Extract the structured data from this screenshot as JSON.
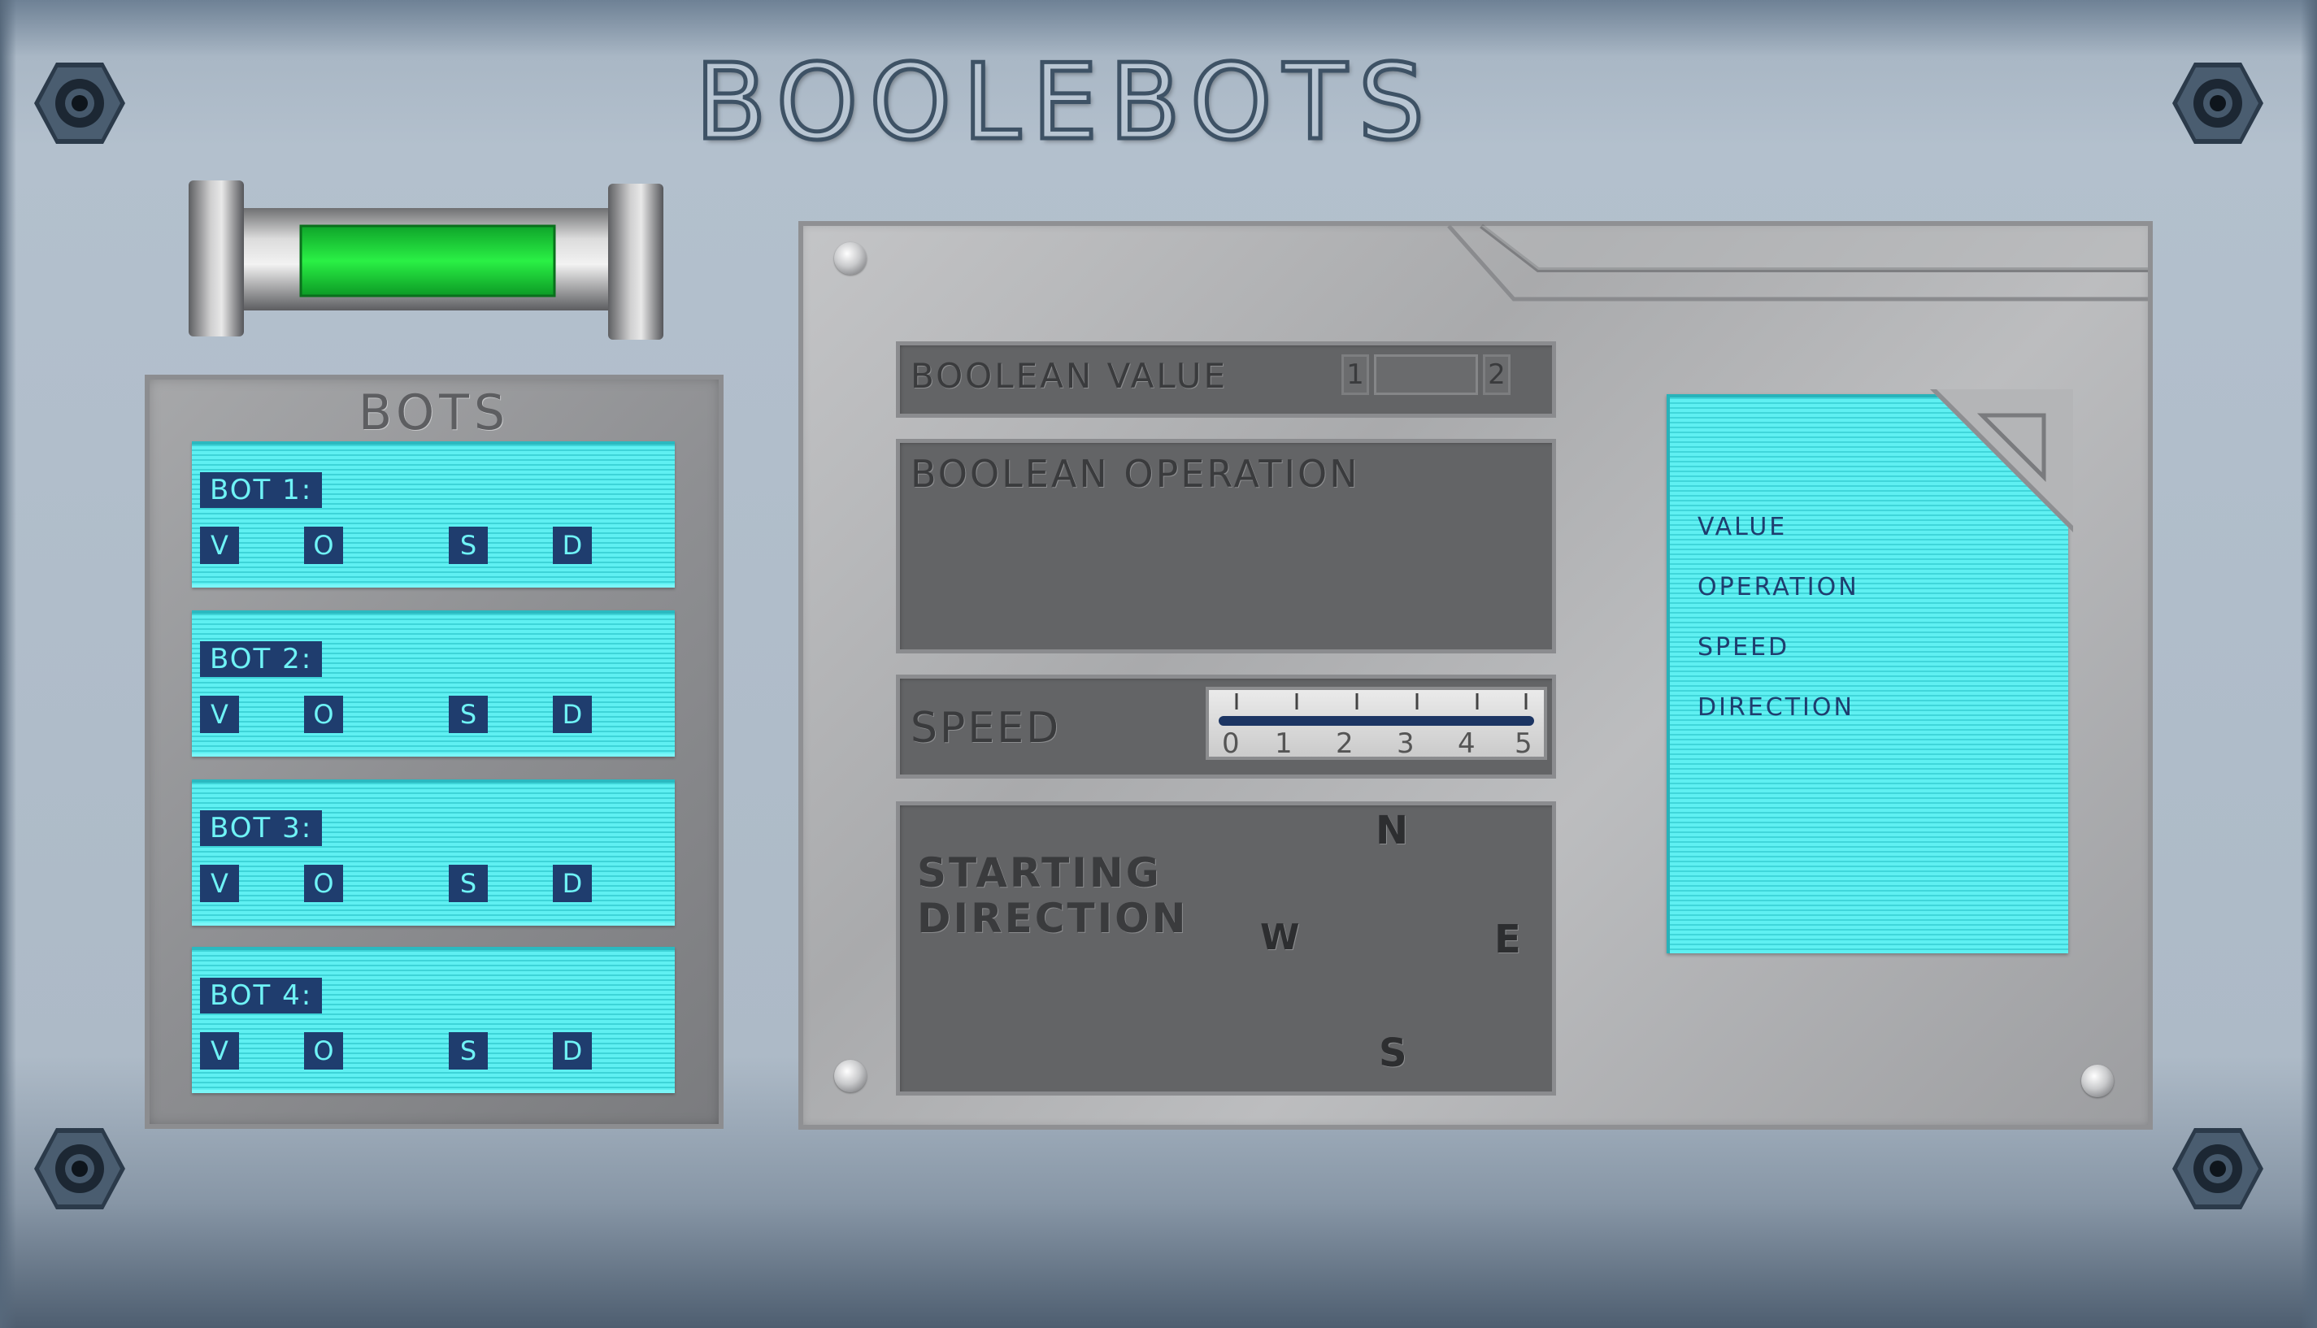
{
  "title": "BOOLEBOTS",
  "bots_panel": {
    "title": "BOTS",
    "bots": [
      {
        "label": "BOT 1:",
        "buttons": [
          "V",
          "O",
          "S",
          "D"
        ]
      },
      {
        "label": "BOT 2:",
        "buttons": [
          "V",
          "O",
          "S",
          "D"
        ]
      },
      {
        "label": "BOT 3:",
        "buttons": [
          "V",
          "O",
          "S",
          "D"
        ]
      },
      {
        "label": "BOT 4:",
        "buttons": [
          "V",
          "O",
          "S",
          "D"
        ]
      }
    ]
  },
  "boolean_value": {
    "label": "BOOLEAN VALUE",
    "option_1": "1",
    "option_2": "2"
  },
  "boolean_operation": {
    "label": "BOOLEAN OPERATION"
  },
  "speed": {
    "label": "SPEED",
    "ticks": [
      "0",
      "1",
      "2",
      "3",
      "4",
      "5"
    ]
  },
  "starting_direction": {
    "label_line1": "STARTING",
    "label_line2": "DIRECTION",
    "n": "N",
    "s": "S",
    "e": "E",
    "w": "W"
  },
  "info_screen": {
    "items": [
      "VALUE",
      "OPERATION",
      "SPEED",
      "DIRECTION"
    ]
  },
  "colors": {
    "screen": "#5ff0f2",
    "dark_blue": "#1f3d6e",
    "tube_green": "#1ee23a",
    "metal": "#a9aaac"
  }
}
